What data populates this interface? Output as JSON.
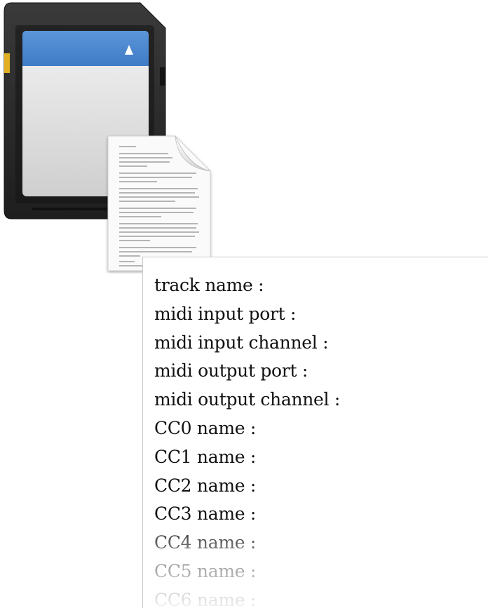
{
  "fields": [
    {
      "label": "track name :"
    },
    {
      "label": "midi input port :"
    },
    {
      "label": "midi input channel :"
    },
    {
      "label": "midi output port :"
    },
    {
      "label": "midi output channel :"
    },
    {
      "label": "CC0 name :"
    },
    {
      "label": "CC1 name :"
    },
    {
      "label": "CC2 name :"
    },
    {
      "label": "CC3 name :"
    },
    {
      "label": "CC4 name :"
    },
    {
      "label": "CC5 name :"
    },
    {
      "label": "CC6 name :"
    }
  ],
  "icons": {
    "sd_card": "sd-card-icon",
    "document": "text-document-icon"
  },
  "colors": {
    "sd_card_body": "#2b2b2b",
    "sd_card_label_top": "#4a86cf",
    "sd_card_label_bottom": "#d8d8d8",
    "gold_contact": "#e0b020",
    "text": "#111111",
    "panel_border": "#c9c9c9"
  }
}
